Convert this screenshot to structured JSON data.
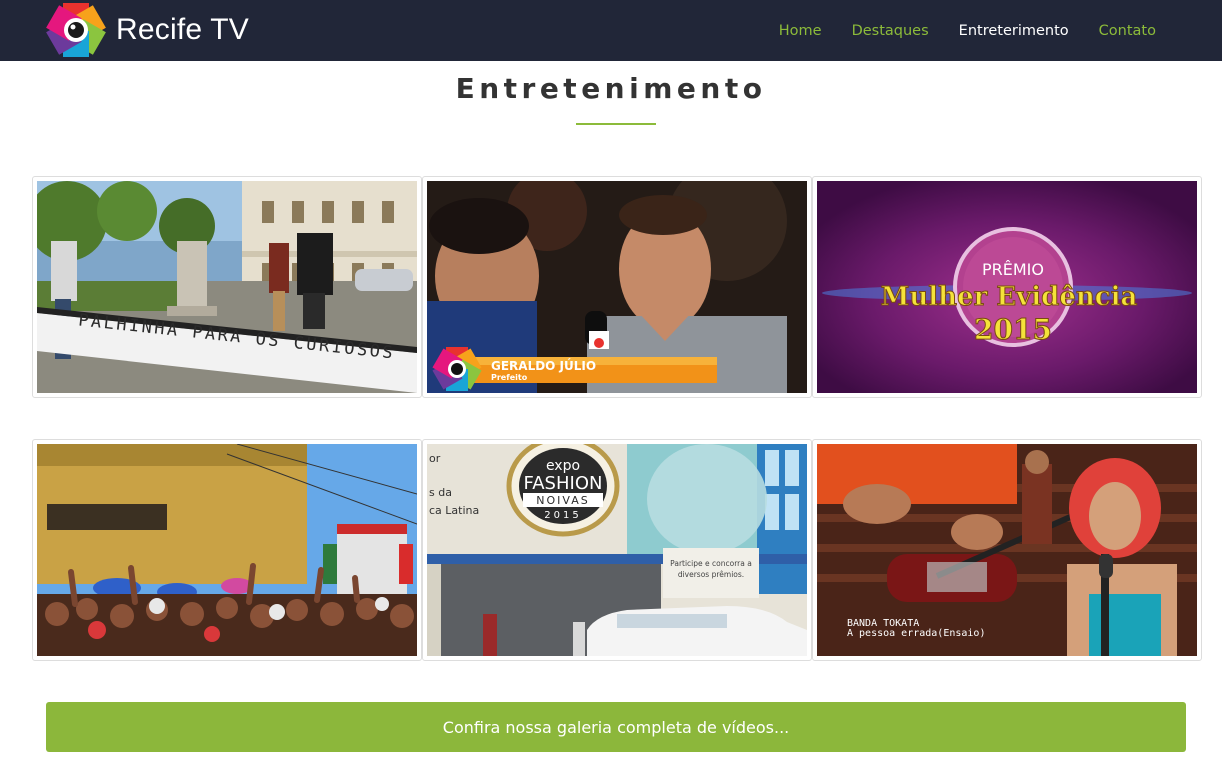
{
  "brand": {
    "name": "Recife TV"
  },
  "nav": {
    "items": [
      {
        "label": "Home",
        "active": false
      },
      {
        "label": "Destaques",
        "active": false
      },
      {
        "label": "Entreterimento",
        "active": true
      },
      {
        "label": "Contato",
        "active": false
      }
    ]
  },
  "section": {
    "title": "Entretenimento"
  },
  "videos": [
    {
      "overlay_text": "PALHINHA PARA OS CURIOSOS"
    },
    {
      "lower_third_name": "GERALDO JÚLIO",
      "lower_third_role": "Prefeito"
    },
    {
      "line1": "PRÊMIO",
      "line2": "Mulher Evidência",
      "line3": "2015"
    },
    {},
    {
      "sign_line1": "expo",
      "sign_line2": "FASHION",
      "sign_line3": "NOIVAS",
      "sign_line4": "2015",
      "wall_text_1": "or",
      "wall_text_2": "s da",
      "wall_text_3": "ca Latina",
      "banner_line1": "Participe e concorra a",
      "banner_line2": "diversos prêmios."
    },
    {
      "caption_line1": "BANDA TOKATA",
      "caption_line2": "A pessoa errada(Ensaio)"
    }
  ],
  "gallery_button": {
    "label": "Confira nossa galeria completa de vídeos..."
  },
  "colors": {
    "navbar": "#212638",
    "accent": "#8cbb3a",
    "button": "#8cb73b"
  }
}
